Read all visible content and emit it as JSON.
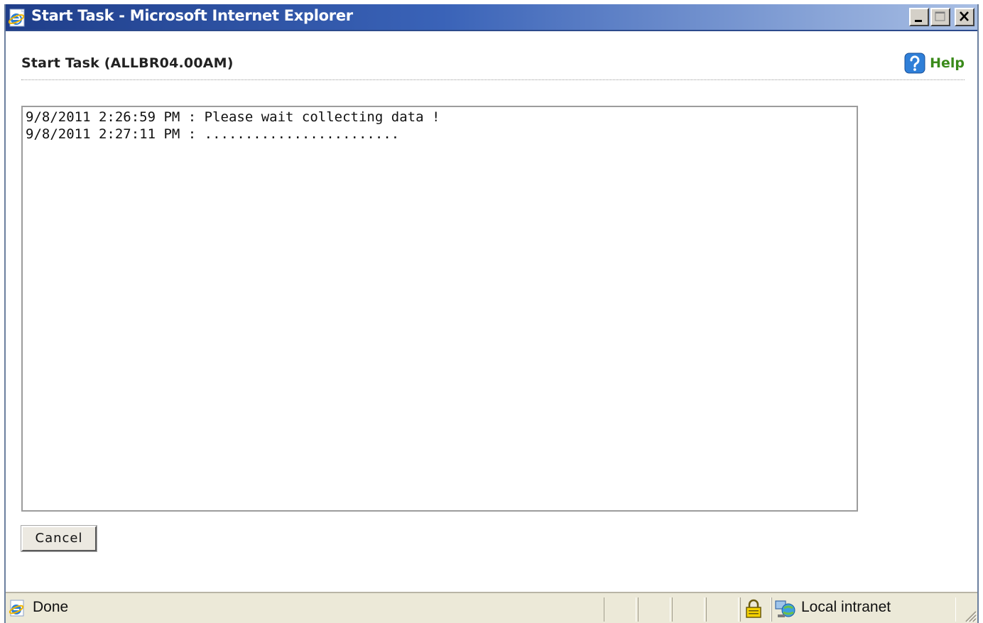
{
  "window": {
    "title": "Start Task - Microsoft Internet Explorer",
    "controls": {
      "minimize": "minimize-icon",
      "maximize": "maximize-icon",
      "close": "close-icon"
    }
  },
  "header": {
    "title": "Start Task (ALLBR04.00AM)",
    "help_label": "Help",
    "help_icon": "help-icon",
    "help_color": "#3a8a1a"
  },
  "log": {
    "lines": [
      "9/8/2011 2:26:59 PM : Please wait collecting data !",
      "9/8/2011 2:27:11 PM : ........................"
    ]
  },
  "actions": {
    "cancel_label": "Cancel"
  },
  "statusbar": {
    "status_text": "Done",
    "zone_text": "Local intranet",
    "icons": [
      "ie-page-icon",
      "lock-icon",
      "local-intranet-icon"
    ]
  }
}
